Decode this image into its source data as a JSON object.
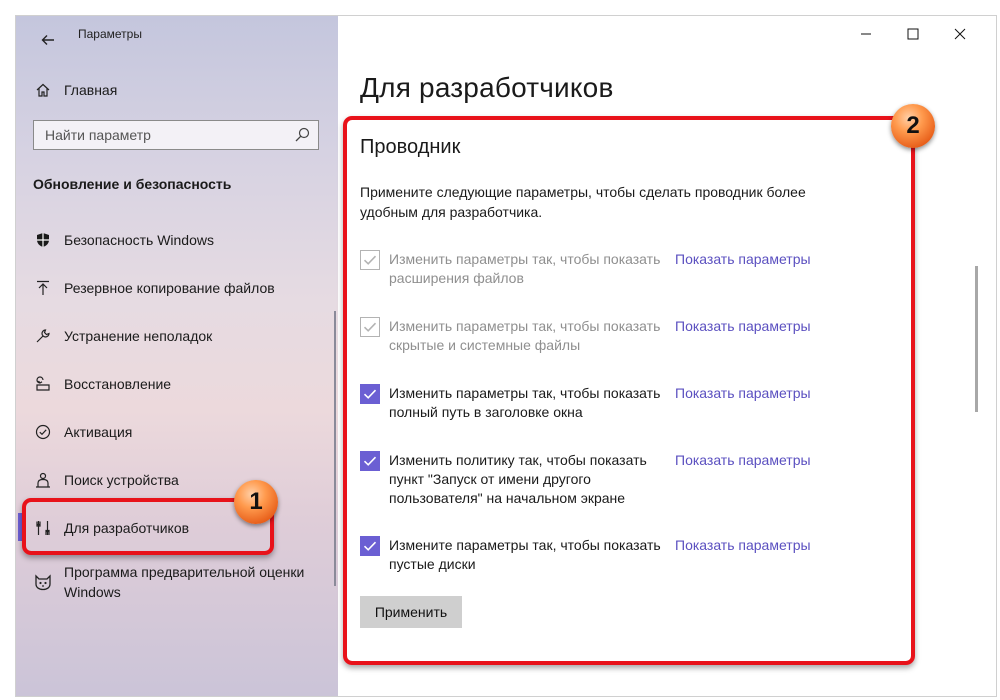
{
  "window": {
    "title": "Параметры",
    "controls": [
      "minimize",
      "maximize",
      "close"
    ]
  },
  "sidebar": {
    "home_label": "Главная",
    "search_placeholder": "Найти параметр",
    "section_header": "Обновление и безопасность",
    "items": [
      {
        "label": "Безопасность Windows",
        "icon": "shield-icon",
        "selected": false
      },
      {
        "label": "Резервное копирование файлов",
        "icon": "backup-arrow-icon",
        "selected": false
      },
      {
        "label": "Устранение неполадок",
        "icon": "wrench-icon",
        "selected": false
      },
      {
        "label": "Восстановление",
        "icon": "recovery-icon",
        "selected": false
      },
      {
        "label": "Активация",
        "icon": "check-circle-icon",
        "selected": false
      },
      {
        "label": "Поиск устройства",
        "icon": "person-pin-icon",
        "selected": false
      },
      {
        "label": "Для разработчиков",
        "icon": "developer-tools-icon",
        "selected": true
      },
      {
        "label": "Программа предварительной оценки Windows",
        "icon": "insider-cat-icon",
        "selected": false
      }
    ]
  },
  "main": {
    "page_title": "Для разработчиков",
    "section_title": "Проводник",
    "description": "Примените следующие параметры, чтобы сделать проводник более удобным для разработчика.",
    "options": [
      {
        "text": "Изменить параметры так, чтобы показать расширения файлов",
        "link": "Показать параметры",
        "checked": true,
        "disabled": true
      },
      {
        "text": "Изменить параметры так, чтобы показать скрытые и системные файлы",
        "link": "Показать параметры",
        "checked": true,
        "disabled": true
      },
      {
        "text": "Изменить параметры так, чтобы показать полный путь в заголовке окна",
        "link": "Показать параметры",
        "checked": true,
        "disabled": false
      },
      {
        "text": "Изменить политику так, чтобы показать пункт \"Запуск от имени другого пользователя\" на начальном экране",
        "link": "Показать параметры",
        "checked": true,
        "disabled": false
      },
      {
        "text": "Измените параметры так, чтобы показать пустые диски",
        "link": "Показать параметры",
        "checked": true,
        "disabled": false
      }
    ],
    "apply_label": "Применить"
  },
  "annotations": [
    {
      "number": "1",
      "color": "#e8121a"
    },
    {
      "number": "2",
      "color": "#e8121a"
    }
  ],
  "colors": {
    "accent": "#6b5fd3",
    "link": "#5b50c0",
    "highlight": "#e8121a",
    "badge": "#ff8a3c"
  }
}
